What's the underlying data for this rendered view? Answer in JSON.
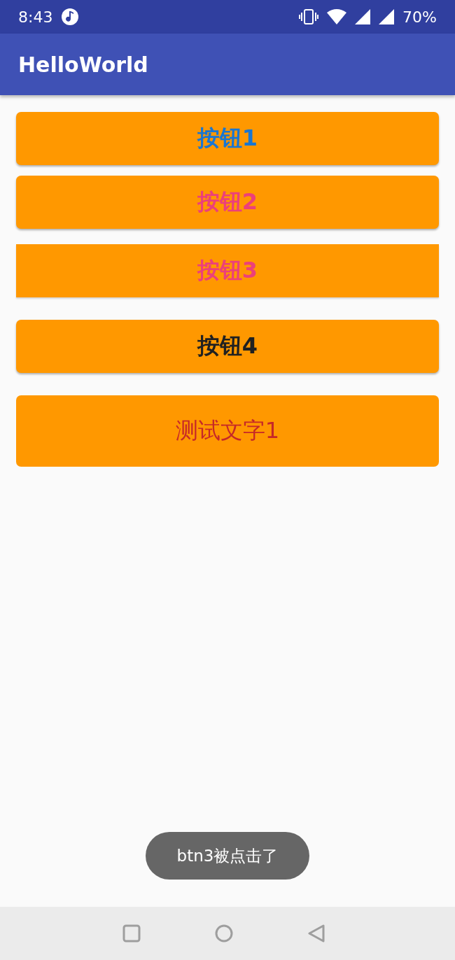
{
  "status_bar": {
    "time": "8:43",
    "battery": "70%"
  },
  "app_bar": {
    "title": "HelloWorld"
  },
  "buttons": [
    {
      "kind": "raised",
      "label": "按钮1",
      "color": "#1976d2"
    },
    {
      "kind": "raised",
      "label": "按钮2",
      "color": "#ec407a"
    },
    {
      "kind": "flat",
      "label": "按钮3",
      "color": "#ec407a"
    },
    {
      "kind": "raised",
      "label": "按钮4",
      "color": "#212121"
    },
    {
      "kind": "text",
      "label": "测试文字1",
      "color": "#c62828"
    }
  ],
  "toast": {
    "message": "btn3被点击了"
  }
}
